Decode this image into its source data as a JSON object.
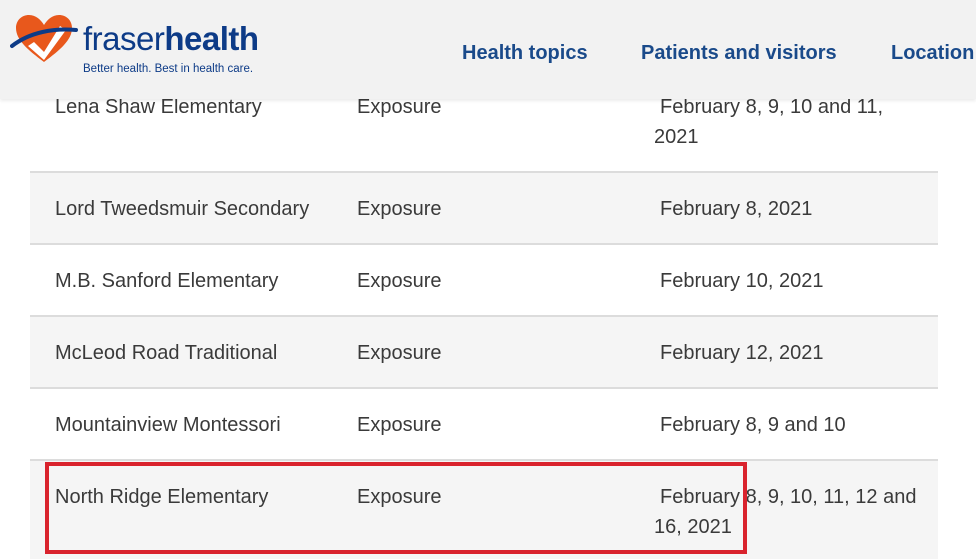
{
  "header": {
    "brand_part1": "fraser",
    "brand_part2": "health",
    "tagline": "Better health. Best in health care.",
    "colors": {
      "brand_blue": "#0d3b87",
      "brand_orange": "#e8581c",
      "nav_blue": "#1a4a8a"
    }
  },
  "nav": {
    "items": [
      {
        "label": "Health topics"
      },
      {
        "label": "Patients and visitors"
      },
      {
        "label": "Location"
      }
    ]
  },
  "table": {
    "rows": [
      {
        "school": "Lena Shaw Elementary",
        "type": "Exposure",
        "date": "February 8, 9, 10 and 11, 2021"
      },
      {
        "school": "Lord Tweedsmuir Secondary",
        "type": "Exposure",
        "date": "February 8, 2021"
      },
      {
        "school": "M.B. Sanford Elementary",
        "type": "Exposure",
        "date": "February 10, 2021"
      },
      {
        "school": "McLeod Road Traditional",
        "type": "Exposure",
        "date": "February 12, 2021"
      },
      {
        "school": "Mountainview Montessori",
        "type": "Exposure",
        "date": "February 8, 9 and 10"
      },
      {
        "school": "North Ridge Elementary",
        "type": "Exposure",
        "date": "February 8, 9, 10, 11, 12 and 16, 2021"
      }
    ]
  },
  "annotation": {
    "highlight_color": "#d9232d"
  }
}
